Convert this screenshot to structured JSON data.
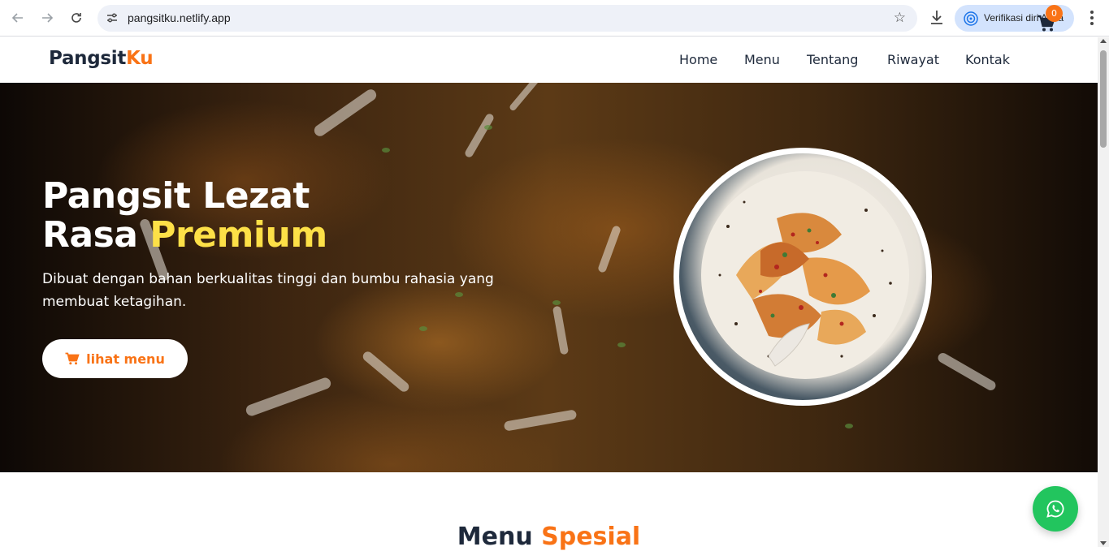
{
  "browser": {
    "url": "pangsitku.netlify.app",
    "profile_label": "Verifikasi diri Anda"
  },
  "header": {
    "logo_main": "Pangsit",
    "logo_accent": "Ku",
    "nav": [
      "Home",
      "Menu",
      "Tentang",
      "Riwayat",
      "Kontak"
    ],
    "cart_count": "0"
  },
  "hero": {
    "title_line1": "Pangsit Lezat",
    "title_line2_prefix": "Rasa ",
    "title_line2_highlight": "Premium",
    "subtitle": "Dibuat dengan bahan berkualitas tinggi dan bumbu rahasia yang membuat ketagihan.",
    "cta_label": "lihat menu"
  },
  "section": {
    "title_main": "Menu ",
    "title_accent": "Spesial"
  },
  "colors": {
    "accent": "#f97316",
    "highlight": "#fde047",
    "dark": "#1e293b",
    "whatsapp": "#22c55e"
  }
}
